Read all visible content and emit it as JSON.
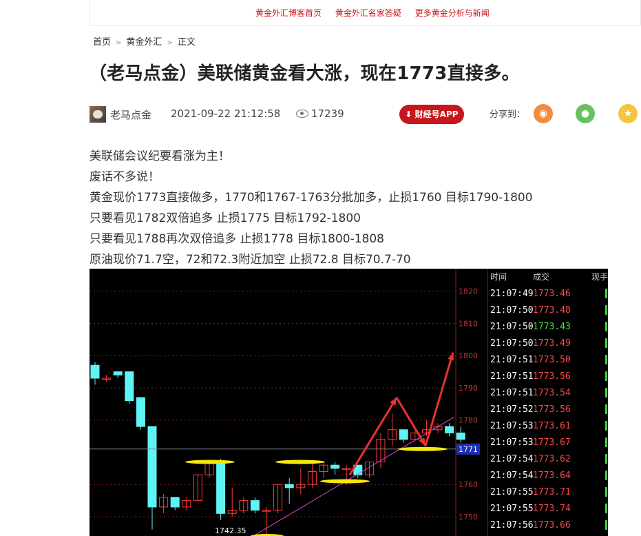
{
  "topnav": [
    "黄金外汇博客首页",
    "黄金外汇名家答疑",
    "更多黄金分析与新闻"
  ],
  "breadcrumb": [
    "首页",
    "黄金外汇",
    "正文"
  ],
  "title": "（老马点金）美联储黄金看大涨，现在1773直接多。",
  "meta": {
    "author": "老马点金",
    "datetime": "2021-09-22 21:12:58",
    "views": "17239",
    "app_button": "财经号APP",
    "share_label": "分享到："
  },
  "content": [
    "美联储会议纪要看涨为主！",
    "废话不多说！",
    "黄金现价1773直接做多，1770和1767-1763分批加多，止损1760 目标1790-1800",
    "只要看见1782双倍追多 止损1775 目标1792-1800",
    "只要看见1788再次双倍追多 止损1778 目标1800-1808",
    "原油现价71.7空，72和72.3附近加空 止损72.8 目标70.7-70"
  ],
  "chart_data": {
    "type": "candlestick",
    "y_ticks": [
      1820,
      1810,
      1800,
      1790,
      1780,
      1760,
      1750
    ],
    "ylim": [
      1744,
      1827
    ],
    "current_price_label": "1771",
    "low_label": "1742.35",
    "colors": {
      "up": "#ff3b3b",
      "down": "#5ff4f4",
      "line": "#d848d8",
      "arrow": "#e8332f",
      "ellipse": "#f4e80c"
    }
  },
  "ticker": {
    "headers": [
      "时间",
      "成交",
      "现手"
    ],
    "rows": [
      {
        "time": "21:07:49",
        "price": "1773.46",
        "dir": "up"
      },
      {
        "time": "21:07:50",
        "price": "1773.48",
        "dir": "up"
      },
      {
        "time": "21:07:50",
        "price": "1773.43",
        "dir": "down"
      },
      {
        "time": "21:07:50",
        "price": "1773.49",
        "dir": "up"
      },
      {
        "time": "21:07:51",
        "price": "1773.50",
        "dir": "up"
      },
      {
        "time": "21:07:51",
        "price": "1773.56",
        "dir": "up"
      },
      {
        "time": "21:07:51",
        "price": "1773.54",
        "dir": "up"
      },
      {
        "time": "21:07:52",
        "price": "1773.56",
        "dir": "up"
      },
      {
        "time": "21:07:53",
        "price": "1773.61",
        "dir": "up"
      },
      {
        "time": "21:07:53",
        "price": "1773.67",
        "dir": "up"
      },
      {
        "time": "21:07:54",
        "price": "1773.62",
        "dir": "up"
      },
      {
        "time": "21:07:54",
        "price": "1773.64",
        "dir": "up"
      },
      {
        "time": "21:07:55",
        "price": "1773.71",
        "dir": "up"
      },
      {
        "time": "21:07:55",
        "price": "1773.74",
        "dir": "up"
      },
      {
        "time": "21:07:56",
        "price": "1773.66",
        "dir": "up"
      }
    ]
  }
}
